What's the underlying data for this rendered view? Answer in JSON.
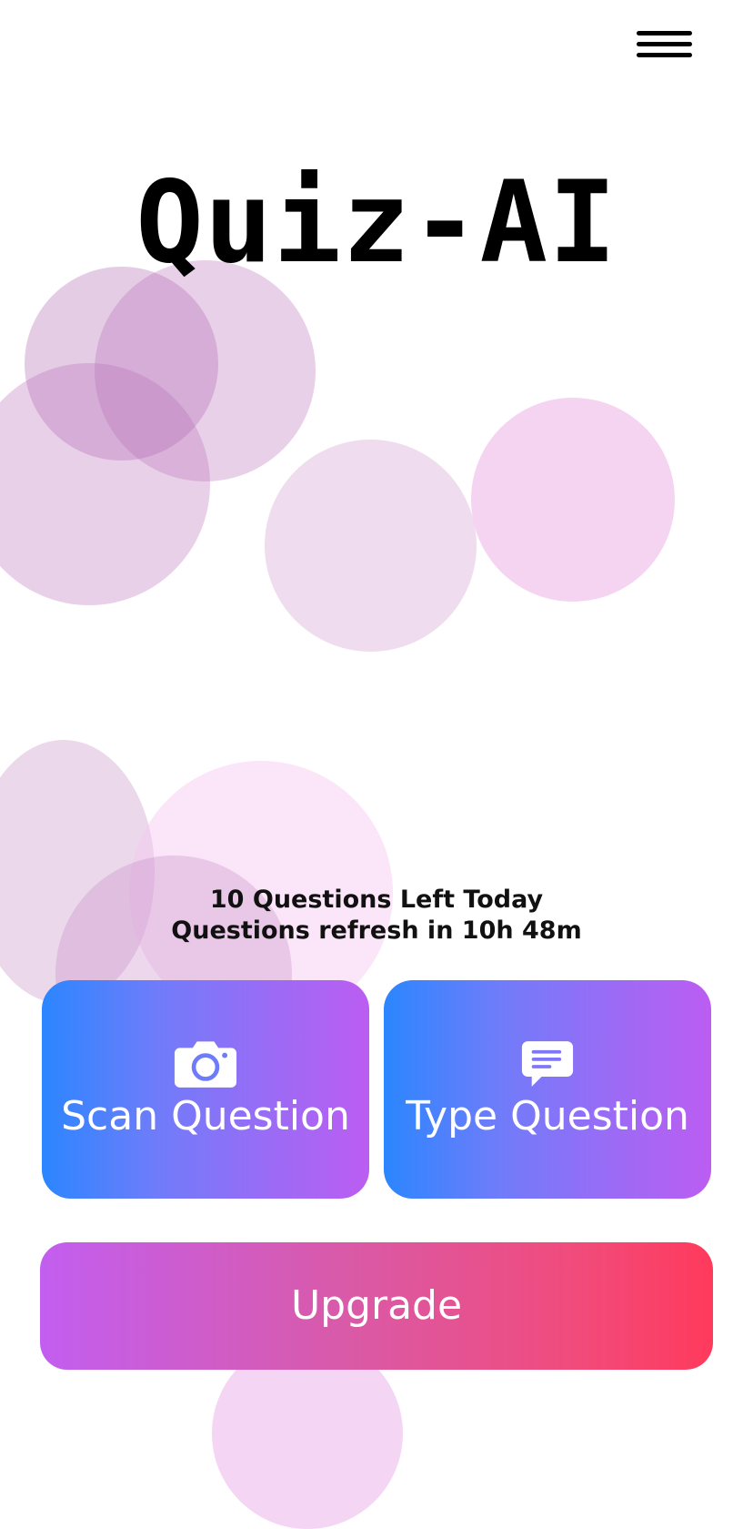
{
  "app": {
    "title": "Quiz-AI"
  },
  "quota": {
    "questions_left": "10 Questions Left Today",
    "refresh": "Questions refresh in 10h 48m"
  },
  "actions": {
    "scan_label": "Scan Question",
    "type_label": "Type Question",
    "upgrade_label": "Upgrade"
  },
  "icons": {
    "menu": "hamburger-menu-icon",
    "scan": "camera-icon",
    "type": "chat-bubble-icon"
  },
  "colors": {
    "tile_gradient_start": "#2b86ff",
    "tile_gradient_end": "#bc5df2",
    "upgrade_gradient_start": "#c25ef0",
    "upgrade_gradient_end": "#ff3a5c",
    "bubble": "#c98fc9"
  }
}
